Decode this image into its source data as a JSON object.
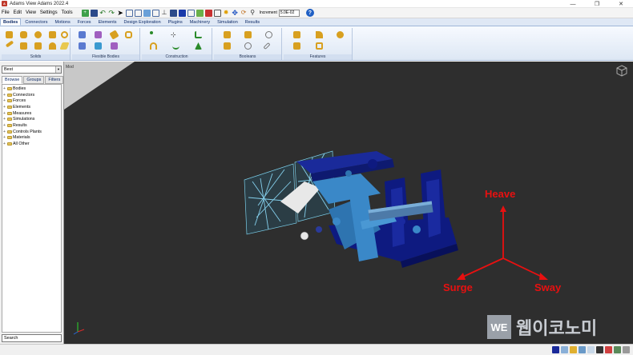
{
  "window": {
    "title": "Adams   View Adams 2022.4",
    "minimize": "—",
    "maximize": "❐",
    "close": "✕"
  },
  "menu": [
    "File",
    "Edit",
    "View",
    "Settings",
    "Tools"
  ],
  "toolbar": {
    "increment_label": "Increment",
    "increment_value": "5.0E-02"
  },
  "ribbon_tabs": [
    "Bodies",
    "Connectors",
    "Motions",
    "Forces",
    "Elements",
    "Design Exploration",
    "Plugins",
    "Machinery",
    "Simulation",
    "Results"
  ],
  "ribbon_groups": [
    "Solids",
    "Flexible Bodies",
    "Construction",
    "Booleans",
    "Features"
  ],
  "viewport": {
    "label": "Mod",
    "background": "#2e2e2e",
    "axes": {
      "heave": "Heave",
      "surge": "Surge",
      "sway": "Sway",
      "color": "#e81010"
    }
  },
  "left_panel": {
    "model_select": "Best",
    "tabs": [
      "Browse",
      "Groups",
      "Filters"
    ],
    "tree": [
      "Bodies",
      "Connectors",
      "Forces",
      "Elements",
      "Measures",
      "Simulations",
      "Results",
      "Controls Plants",
      "Materials",
      "All Other"
    ],
    "search_placeholder": "Search"
  },
  "watermark": {
    "logo": "WE",
    "text": "웹이코노미"
  }
}
